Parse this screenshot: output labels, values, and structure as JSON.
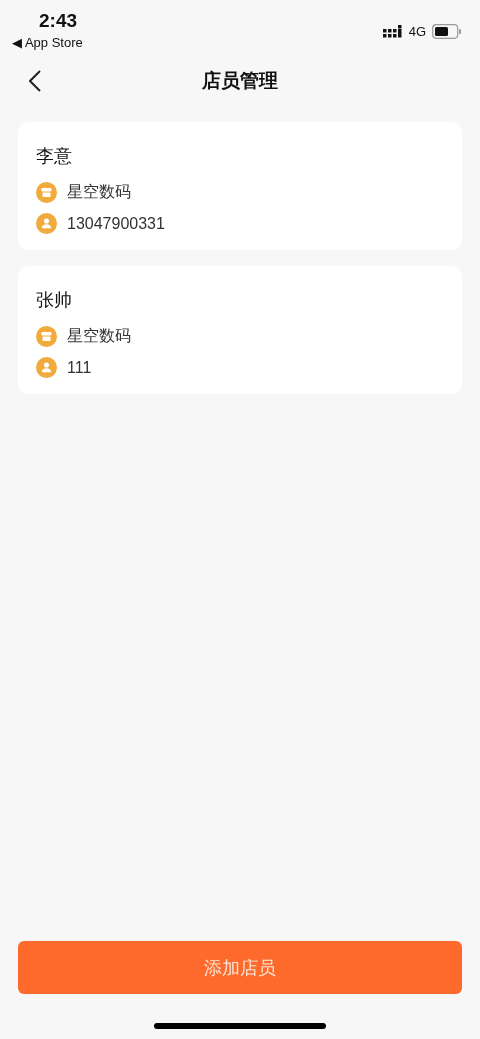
{
  "status_bar": {
    "time": "2:43",
    "back_label": "◀ App Store",
    "network": "4G"
  },
  "nav": {
    "title": "店员管理"
  },
  "staff": [
    {
      "name": "李意",
      "details": [
        {
          "kind": "shop",
          "text": "星空数码"
        },
        {
          "kind": "person",
          "text": "13047900331"
        }
      ]
    },
    {
      "name": "张帅",
      "details": [
        {
          "kind": "shop",
          "text": "星空数码"
        },
        {
          "kind": "person",
          "text": "111"
        }
      ]
    }
  ],
  "add_button": "添加店员"
}
